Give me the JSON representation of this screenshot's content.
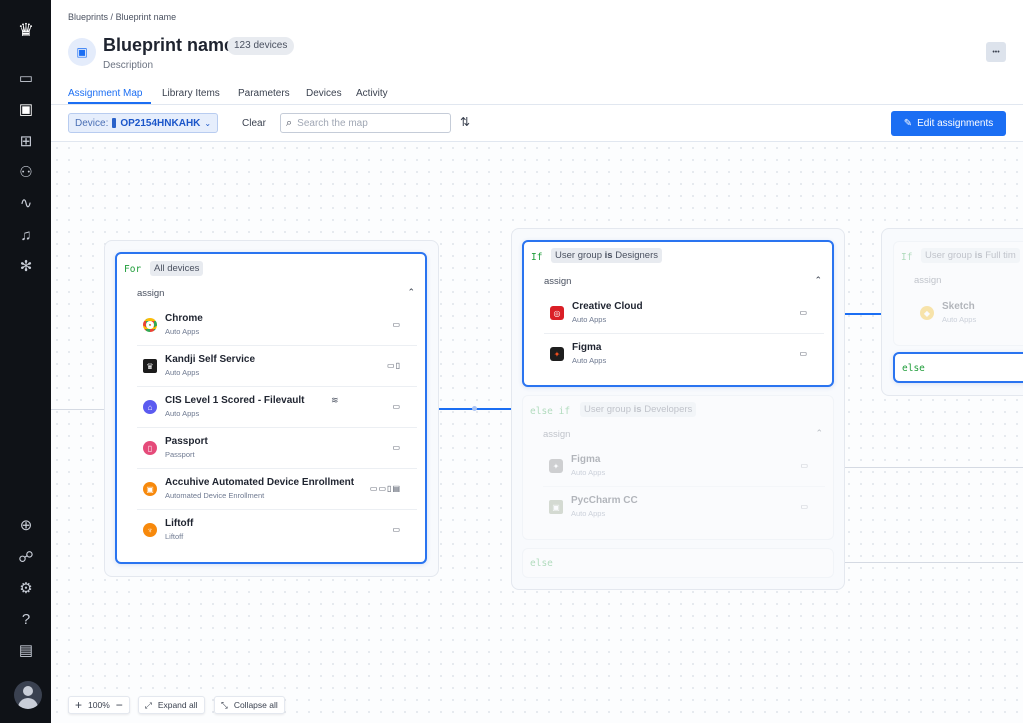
{
  "breadcrumb": [
    "Blueprints",
    "/",
    "Blueprint name"
  ],
  "header": {
    "title": "Blueprint name",
    "badge": "123 devices",
    "description": "Description",
    "more": "•••"
  },
  "tabs": [
    {
      "label": "Assignment Map",
      "active": true
    },
    {
      "label": "Library Items"
    },
    {
      "label": "Parameters"
    },
    {
      "label": "Devices"
    },
    {
      "label": "Activity"
    }
  ],
  "toolbar": {
    "device_label": "Device:",
    "device_value": "OP2154HNKAHK",
    "clear": "Clear",
    "search_placeholder": "Search the map",
    "edit": "Edit assignments"
  },
  "colors": {
    "accent": "#1b6ef3",
    "sidebar": "#0f1217",
    "keyword": "#1f9d3a"
  },
  "node_for": {
    "keyword": "For",
    "condition": "All devices",
    "assign": "assign",
    "items": [
      {
        "name": "Chrome",
        "sub": "Auto Apps",
        "icon": "chrome-icon",
        "devices": "🖥"
      },
      {
        "name": "Kandji Self Service",
        "sub": "Auto Apps",
        "icon": "kandji-icon",
        "devices": "💻📱"
      },
      {
        "name": "CIS Level 1 Scored - Filevault",
        "sub": "Auto Apps",
        "icon": "shield-icon",
        "devices": "🖥"
      },
      {
        "name": "Passport",
        "sub": "Passport",
        "icon": "passport-icon",
        "devices": "🖥"
      },
      {
        "name": "Accuhive Automated Device Enrollment",
        "sub": "Automated Device Enrollment",
        "icon": "ade-icon",
        "devices": "🖥💻📱📺"
      },
      {
        "name": "Liftoff",
        "sub": "Liftoff",
        "icon": "liftoff-icon",
        "devices": "🖥"
      }
    ]
  },
  "node_if": {
    "keyword": "If",
    "condition_pre": "User group",
    "condition_is": "is",
    "condition_val": "Designers",
    "assign": "assign",
    "items": [
      {
        "name": "Creative Cloud",
        "sub": "Auto Apps",
        "icon": "creative-cloud-icon"
      },
      {
        "name": "Figma",
        "sub": "Auto Apps",
        "icon": "figma-icon"
      }
    ]
  },
  "node_elseif": {
    "keyword": "else if",
    "condition_pre": "User group",
    "condition_is": "is",
    "condition_val": "Developers",
    "assign": "assign",
    "items": [
      {
        "name": "Figma",
        "sub": "Auto Apps",
        "icon": "figma-icon"
      },
      {
        "name": "PycCharm CC",
        "sub": "Auto Apps",
        "icon": "pycharm-icon"
      }
    ]
  },
  "node_else": {
    "keyword": "else"
  },
  "node_right": {
    "keyword": "If",
    "condition_pre": "User group",
    "condition_is": "is",
    "condition_val": "Full tim",
    "assign": "assign",
    "items": [
      {
        "name": "Sketch",
        "sub": "Auto Apps",
        "icon": "sketch-icon"
      }
    ],
    "else": "else"
  },
  "zoom": {
    "level": "100%",
    "plus": "+",
    "minus": "−",
    "expand": "Expand all",
    "collapse": "Collapse all"
  }
}
